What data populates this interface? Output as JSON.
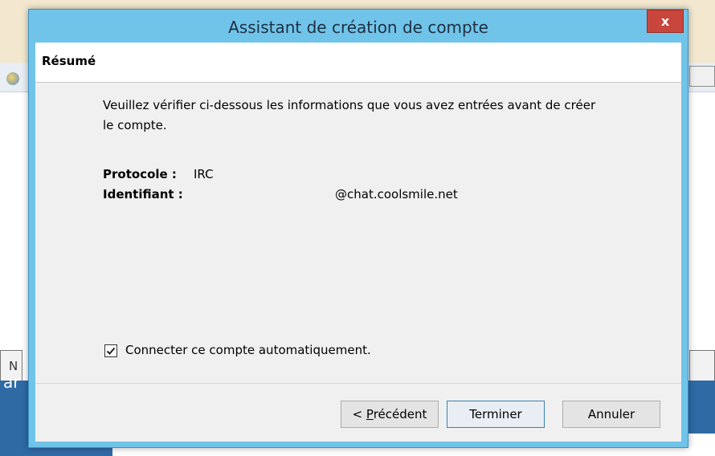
{
  "dialog": {
    "title": "Assistant de création de compte",
    "close_label": "x",
    "header": "Résumé",
    "description": "Veuillez vérifier ci-dessous les informations que vous avez entrées avant de créer le compte.",
    "protocol_label": "Protocole :",
    "protocol_value": "IRC",
    "identifier_label": "Identifiant :",
    "identifier_value": "@chat.coolsmile.net",
    "auto_connect_label": "Connecter ce compte automatiquement.",
    "auto_connect_checked": true,
    "buttons": {
      "previous_prefix": "< ",
      "previous_mnemonic": "P",
      "previous_rest": "récédent",
      "finish": "Terminer",
      "cancel": "Annuler"
    }
  },
  "background": {
    "left_button_char": "N",
    "partial_text": "ar"
  },
  "colors": {
    "titlebar": "#70c4ea",
    "close_button": "#c9463d",
    "panel": "#f0f0f0"
  }
}
